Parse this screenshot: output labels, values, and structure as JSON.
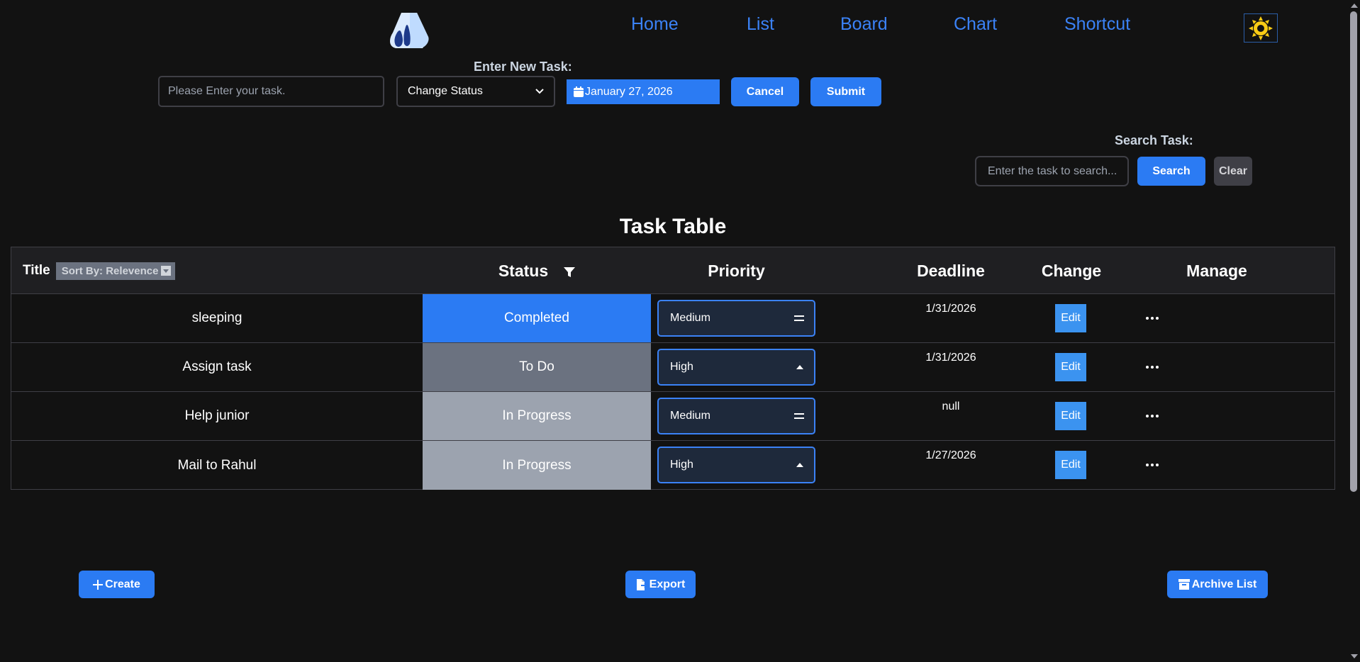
{
  "nav": {
    "links": [
      "Home",
      "List",
      "Board",
      "Chart",
      "Shortcut"
    ]
  },
  "icons": {
    "logo": "drop-logo-icon",
    "theme": "sun-icon",
    "calendar": "calendar-icon",
    "filter": "filter-icon",
    "sort": "caret-down-icon",
    "more": "ellipsis-icon",
    "plus": "plus-icon",
    "export": "file-export-icon",
    "archive": "archive-icon"
  },
  "colors": {
    "accent": "#2b7bf3",
    "background": "#121212",
    "completed": "#2b7bf3",
    "todo": "#6b7280",
    "in_progress": "#9ca3af",
    "theme_sun": "#facc15"
  },
  "new_task": {
    "label": "Enter New Task:",
    "placeholder": "Please Enter your task.",
    "status_select": "Change Status",
    "date": "January 27, 2026",
    "cancel_label": "Cancel",
    "submit_label": "Submit"
  },
  "search": {
    "label": "Search Task:",
    "placeholder": "Enter the task to search...",
    "search_label": "Search",
    "clear_label": "Clear"
  },
  "table": {
    "title": "Task Table",
    "headers": {
      "title": "Title",
      "sort": "Sort By: Relevence",
      "status": "Status",
      "priority": "Priority",
      "deadline": "Deadline",
      "change": "Change",
      "manage": "Manage"
    },
    "rows": [
      {
        "title": "sleeping",
        "status": "Completed",
        "status_color": "#2b7bf3",
        "priority": "Medium",
        "priority_icon": "equals-icon",
        "deadline": "1/31/2026",
        "edit": "Edit"
      },
      {
        "title": "Assign task",
        "status": "To Do",
        "status_color": "#6b7280",
        "priority": "High",
        "priority_icon": "caret-up-icon",
        "deadline": "1/31/2026",
        "edit": "Edit"
      },
      {
        "title": "Help junior",
        "status": "In Progress",
        "status_color": "#9ca3af",
        "priority": "Medium",
        "priority_icon": "equals-icon",
        "deadline": "null",
        "edit": "Edit"
      },
      {
        "title": "Mail to Rahul",
        "status": "In Progress",
        "status_color": "#9ca3af",
        "priority": "High",
        "priority_icon": "caret-up-icon",
        "deadline": "1/27/2026",
        "edit": "Edit"
      }
    ]
  },
  "actions": {
    "create": "Create",
    "export": "Export",
    "archive": "Archive List"
  }
}
